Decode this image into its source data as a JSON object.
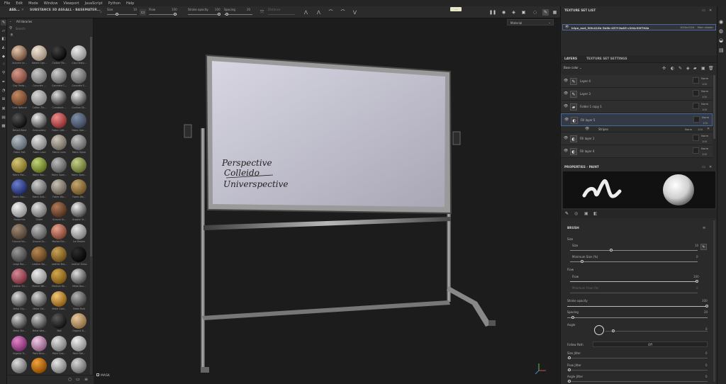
{
  "menu": [
    "File",
    "Edit",
    "Mode",
    "Window",
    "Viewport",
    "JavaScript",
    "Python",
    "Help"
  ],
  "toolbar": {
    "tabs": [
      "ASS...",
      "SUBSTANCE 3D ASS...",
      "ALL - BASEMATER..."
    ],
    "size_label": "Size",
    "size_value": "10",
    "flow_label": "Flow",
    "flow_value": "100",
    "stroke_label": "Stroke opacity",
    "stroke_value": "100",
    "spacing_label": "Spacing",
    "spacing_value": "20",
    "distance_label": "Distance",
    "distance_value": "",
    "tooltip": "..."
  },
  "assets": {
    "breadcrumb": "All libraries",
    "search_placeholder": "Search",
    "items": [
      {
        "label": "Autumn Le...",
        "c1": "#e6c9b0",
        "c2": "#6b4a35"
      },
      {
        "label": "Baked Ligh...",
        "c1": "#f3e6d7",
        "c2": "#9c8a77"
      },
      {
        "label": "Carbon Fib...",
        "c1": "#444",
        "c2": "#050505"
      },
      {
        "label": "Clay Gesto...",
        "c1": "#eee",
        "c2": "#8a8a8a"
      },
      {
        "label": "Clay Tenta...",
        "c1": "#d69a8a",
        "c2": "#7a4338"
      },
      {
        "label": "Concrete ...",
        "c1": "#c9c9c9",
        "c2": "#6b6b6b"
      },
      {
        "label": "Concrete C...",
        "c1": "#cfcfcf",
        "c2": "#5f5f5f"
      },
      {
        "label": "Concrete S...",
        "c1": "#bdbdbd",
        "c2": "#5a5a5a"
      },
      {
        "label": "Cork Natural",
        "c1": "#c48a63",
        "c2": "#6b4028"
      },
      {
        "label": "Cotton Thi...",
        "c1": "#d8d8d8",
        "c2": "#7f7f7f"
      },
      {
        "label": "Curvature ...",
        "c1": "#ddd",
        "c2": "#333"
      },
      {
        "label": "Cushion Sh...",
        "c1": "#eee",
        "c2": "#444"
      },
      {
        "label": "Desert Blast",
        "c1": "#555",
        "c2": "#0b0b0b"
      },
      {
        "label": "Embroidery",
        "c1": "#eee",
        "c2": "#444"
      },
      {
        "label": "Fabric Cott...",
        "c1": "#f08c8c",
        "c2": "#8a2c2c"
      },
      {
        "label": "Fabric Den...",
        "c1": "#7f8fa8",
        "c2": "#394459"
      },
      {
        "label": "Fabric Felt",
        "c1": "#b8c0c8",
        "c2": "#5a636b"
      },
      {
        "label": "Fabric Lace",
        "c1": "#e3e3e3",
        "c2": "#7d7d7d"
      },
      {
        "label": "Fabric Linen",
        "c1": "#cfc8bd",
        "c2": "#6c655a"
      },
      {
        "label": "Fabric Nylon",
        "c1": "#c5c5c5",
        "c2": "#5e5e5e"
      },
      {
        "label": "Fabric Pon...",
        "c1": "#d6c87a",
        "c2": "#7a6a20"
      },
      {
        "label": "Fabric Rou...",
        "c1": "#c3d57a",
        "c2": "#5d6f1c"
      },
      {
        "label": "Fabric Span...",
        "c1": "#bdbdbd",
        "c2": "#555"
      },
      {
        "label": "Fabric Span...",
        "c1": "#c6d28a",
        "c2": "#5f6b2a"
      },
      {
        "label": "Fabric Sou...",
        "c1": "#6a7fd0",
        "c2": "#1d2866"
      },
      {
        "label": "Fabric Suit...",
        "c1": "#d0d0d0",
        "c2": "#5c5c5c"
      },
      {
        "label": "Fabric Wo...",
        "c1": "#c9c1b6",
        "c2": "#625a4f"
      },
      {
        "label": "Fabric Wo...",
        "c1": "#c8a86e",
        "c2": "#6b5023"
      },
      {
        "label": "Footprints",
        "c1": "#f3f3f3",
        "c2": "#8a8a8a"
      },
      {
        "label": "Glitter",
        "c1": "#e0e0e0",
        "c2": "#6a6a6a"
      },
      {
        "label": "Ground Gr...",
        "c1": "#b07b5a",
        "c2": "#4f2f1c"
      },
      {
        "label": "Graphic Vi...",
        "c1": "#eee",
        "c2": "#444"
      },
      {
        "label": "Ground Mu...",
        "c1": "#a08a76",
        "c2": "#4e3e31"
      },
      {
        "label": "Ground Gr...",
        "c1": "#bcbcbc",
        "c2": "#555"
      },
      {
        "label": "Marble Rin...",
        "c1": "#e9a38e",
        "c2": "#7d3f2d"
      },
      {
        "label": "Ice Broken",
        "c1": "#e7e7e7",
        "c2": "#7a7a7a"
      },
      {
        "label": "Large Roc...",
        "c1": "#9a9a9a",
        "c2": "#404040"
      },
      {
        "label": "Leather Bo...",
        "c1": "#b88a55",
        "c2": "#5a3d1a"
      },
      {
        "label": "Leather Bro...",
        "c1": "#c9a55a",
        "c2": "#6b4c14"
      },
      {
        "label": "Leather Gloss",
        "c1": "#2e2e2e",
        "c2": "#050505"
      },
      {
        "label": "Leather Sh...",
        "c1": "#d68a98",
        "c2": "#7a2c3a"
      },
      {
        "label": "Marble Wit...",
        "c1": "#eee",
        "c2": "#8a8a8a"
      },
      {
        "label": "Medium Ro...",
        "c1": "#d3a84e",
        "c2": "#7a5510"
      },
      {
        "label": "Metal Bus...",
        "c1": "#e0e0e0",
        "c2": "#444"
      },
      {
        "label": "Metal Dry...",
        "c1": "#dcdcdc",
        "c2": "#404040"
      },
      {
        "label": "Metal Gal...",
        "c1": "#d6d6d6",
        "c2": "#454545"
      },
      {
        "label": "Metal Gold...",
        "c1": "#f4c978",
        "c2": "#8a5a10"
      },
      {
        "label": "Metal Rust",
        "c1": "#b5b5b5",
        "c2": "#3d3d3d"
      },
      {
        "label": "Metal Ste...",
        "c1": "#d5d5d5",
        "c2": "#3a3a3a"
      },
      {
        "label": "Metal Wea...",
        "c1": "#cdcdcd",
        "c2": "#3d3d3d"
      },
      {
        "label": "Nail",
        "c1": "#5a5a5a",
        "c2": "#101010"
      },
      {
        "label": "Organic B...",
        "c1": "#e9c9a0",
        "c2": "#8a6a3f"
      },
      {
        "label": "Organic Tr...",
        "c1": "#e287c9",
        "c2": "#7a2a6b"
      },
      {
        "label": "Paint Brus...",
        "c1": "#f2c9e8",
        "c2": "#8a5a7d"
      },
      {
        "label": "Paint Crac...",
        "c1": "#e3e3e3",
        "c2": "#777"
      },
      {
        "label": "Paint Roll...",
        "c1": "#f0f0f0",
        "c2": "#888"
      },
      {
        "label": "",
        "c1": "#e0e0e0",
        "c2": "#666"
      },
      {
        "label": "",
        "c1": "#f4a23c",
        "c2": "#8a4a00"
      },
      {
        "label": "",
        "c1": "#e8e8e8",
        "c2": "#777"
      },
      {
        "label": "",
        "c1": "#d8d8d8",
        "c2": "#666"
      }
    ]
  },
  "viewport": {
    "material_select": "Material",
    "whiteboard_lines": [
      "Perspective",
      "Colleido",
      "Universpective"
    ]
  },
  "texture_set_list": {
    "title": "TEXTURE SET LIST",
    "item_name": "tripo_mat_50fc410b-3b6b-457f-8a85-c304c90f764b",
    "item_res": "1024x1024",
    "item_shader": "Main shader"
  },
  "layers": {
    "tabs": [
      "LAYERS",
      "TEXTURE SET SETTINGS"
    ],
    "channel": "Base color",
    "rows": [
      {
        "name": "Layer 4",
        "blend": "Norm",
        "opacity": "100",
        "type": "paint"
      },
      {
        "name": "Layer 3",
        "blend": "Norm",
        "opacity": "100",
        "type": "paint"
      },
      {
        "name": "Folder 1 copy 1",
        "blend": "Norm",
        "opacity": "100",
        "type": "folder"
      },
      {
        "name": "Fill layer 5",
        "blend": "Norm",
        "opacity": "100",
        "type": "fill"
      },
      {
        "name": "Fill layer 1",
        "blend": "Norm",
        "opacity": "100",
        "type": "fill"
      },
      {
        "name": "Fill layer 4",
        "blend": "Norm",
        "opacity": "100",
        "type": "fill"
      }
    ],
    "sub_effect": {
      "name": "Stripes",
      "blend": "Norm",
      "opacity": "100"
    }
  },
  "properties": {
    "title": "PROPERTIES - PAINT",
    "section": "BRUSH",
    "size_group": "Size",
    "size_label": "Size",
    "size_value": "10",
    "min_size_label": "Minimum Size (%)",
    "min_size_value": "0",
    "flow_group": "Flow",
    "flow_label": "Flow",
    "flow_value": "100",
    "min_flow_label": "Minimum Flow (%)",
    "min_flow_value": "0",
    "stroke_label": "Stroke opacity",
    "stroke_value": "100",
    "spacing_label": "Spacing",
    "spacing_value": "20",
    "angle_label": "Angle",
    "angle_value": "0",
    "follow_label": "Follow Path",
    "follow_value": "Off",
    "size_jitter_label": "Size Jitter",
    "size_jitter_value": "0",
    "flow_jitter_label": "Flow Jitter",
    "flow_jitter_value": "0",
    "angle_jitter_label": "Angle Jitter",
    "angle_jitter_value": "0"
  }
}
